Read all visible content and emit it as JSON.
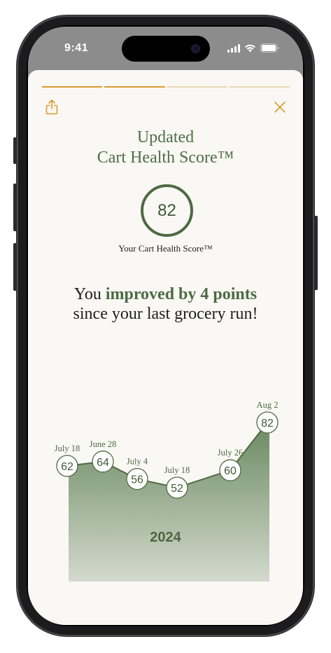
{
  "status_bar": {
    "time": "9:41"
  },
  "progress": {
    "total_steps": 4,
    "active_steps": 2
  },
  "header": {
    "title_line1": "Updated",
    "title_line2": "Cart Health Score™"
  },
  "score": {
    "value": "82",
    "caption": "Your Cart Health Score™"
  },
  "message": {
    "prefix": "You ",
    "emphasis": "improved by 4 points",
    "line2": "since your last grocery run!"
  },
  "chart_data": {
    "type": "area",
    "x": [
      "July 18",
      "June 28",
      "July 4",
      "July 18",
      "July 26",
      "Aug 2"
    ],
    "values": [
      62,
      64,
      56,
      52,
      60,
      82
    ],
    "xlabel": "2024",
    "ylabel": "",
    "ylim": [
      0,
      100
    ],
    "grid": false,
    "colors": {
      "fill_top": "#6a8a60",
      "fill_bottom": "#e4e6df",
      "line": "#4e6a43"
    }
  },
  "colors": {
    "accent": "#dc9a2e",
    "brand_green": "#4e6e46",
    "background": "#faf8f5"
  }
}
